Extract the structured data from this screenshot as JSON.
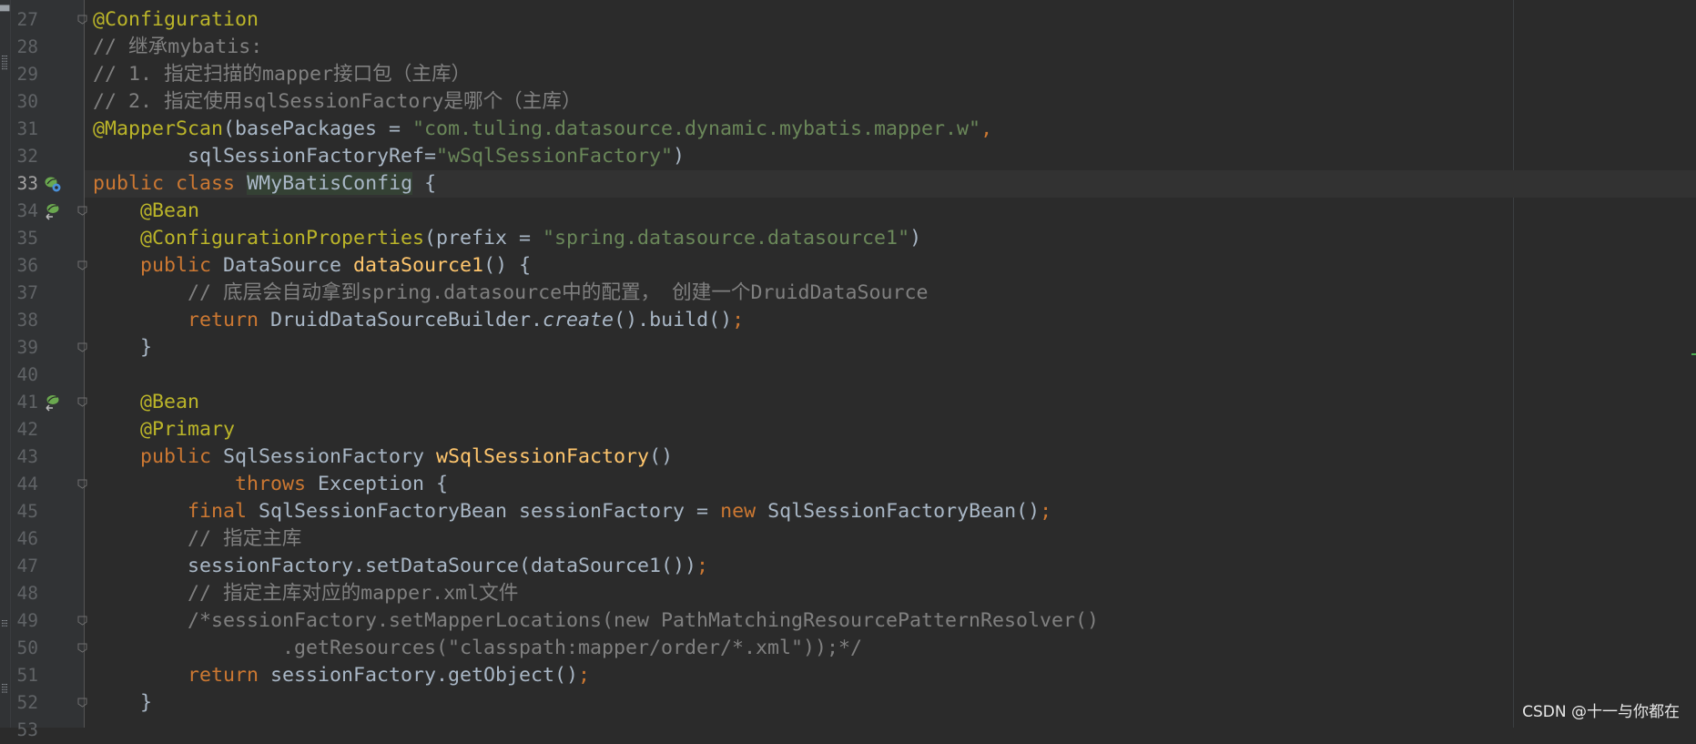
{
  "editor": {
    "language": "Java",
    "current_line": 33,
    "lines": [
      {
        "n": "27",
        "t": "@Configuration"
      },
      {
        "n": "28",
        "t": "// 继承mybatis:"
      },
      {
        "n": "29",
        "t": "// 1. 指定扫描的mapper接口包（主库）"
      },
      {
        "n": "30",
        "t": "// 2. 指定使用sqlSessionFactory是哪个（主库）"
      },
      {
        "n": "31",
        "t": "@MapperScan(basePackages = \"com.tuling.datasource.dynamic.mybatis.mapper.w\","
      },
      {
        "n": "32",
        "t": "        sqlSessionFactoryRef=\"wSqlSessionFactory\")"
      },
      {
        "n": "33",
        "t": "public class WMyBatisConfig {"
      },
      {
        "n": "34",
        "t": "    @Bean"
      },
      {
        "n": "35",
        "t": "    @ConfigurationProperties(prefix = \"spring.datasource.datasource1\")"
      },
      {
        "n": "36",
        "t": "    public DataSource dataSource1() {"
      },
      {
        "n": "37",
        "t": "        // 底层会自动拿到spring.datasource中的配置， 创建一个DruidDataSource"
      },
      {
        "n": "38",
        "t": "        return DruidDataSourceBuilder.create().build();"
      },
      {
        "n": "39",
        "t": "    }"
      },
      {
        "n": "40",
        "t": ""
      },
      {
        "n": "41",
        "t": "    @Bean"
      },
      {
        "n": "42",
        "t": "    @Primary"
      },
      {
        "n": "43",
        "t": "    public SqlSessionFactory wSqlSessionFactory()"
      },
      {
        "n": "44",
        "t": "            throws Exception {"
      },
      {
        "n": "45",
        "t": "        final SqlSessionFactoryBean sessionFactory = new SqlSessionFactoryBean();"
      },
      {
        "n": "46",
        "t": "        // 指定主库"
      },
      {
        "n": "47",
        "t": "        sessionFactory.setDataSource(dataSource1());"
      },
      {
        "n": "48",
        "t": "        // 指定主库对应的mapper.xml文件"
      },
      {
        "n": "49",
        "t": "        /*sessionFactory.setMapperLocations(new PathMatchingResourcePatternResolver()"
      },
      {
        "n": "50",
        "t": "                .getResources(\"classpath:mapper/order/*.xml\"));*/"
      },
      {
        "n": "51",
        "t": "        return sessionFactory.getObject();"
      },
      {
        "n": "52",
        "t": "    }"
      },
      {
        "n": "53",
        "t": ""
      }
    ]
  },
  "gutter_icons": [
    {
      "line": "33",
      "icon": "spring-bean-config-icon"
    },
    {
      "line": "34",
      "icon": "spring-bean-icon"
    },
    {
      "line": "41",
      "icon": "spring-bean-icon"
    }
  ],
  "fold_markers": [
    "27",
    "34",
    "36",
    "39",
    "41",
    "44",
    "49",
    "50",
    "52"
  ],
  "watermark": "CSDN @十一与你都在",
  "colors": {
    "background": "#2b2b2b",
    "gutter": "#313335",
    "line_number": "#606366",
    "annotation": "#bbb529",
    "keyword": "#cc7832",
    "string": "#6a8759",
    "comment": "#808080",
    "method_declaration": "#ffc66d",
    "default_text": "#a9b7c6"
  }
}
